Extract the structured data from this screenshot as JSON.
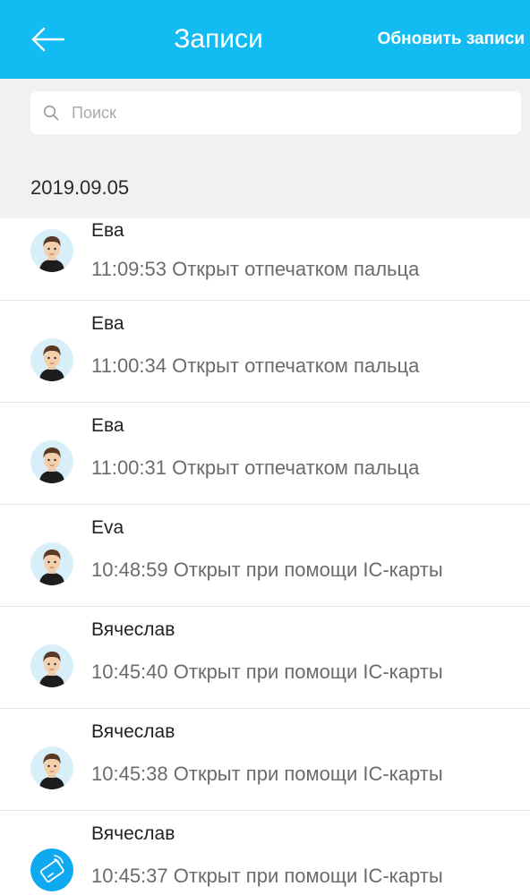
{
  "header": {
    "title": "Записи",
    "refresh_label": "Обновить записи",
    "back_icon": "arrow-left-icon",
    "background": "#12bcf2"
  },
  "search": {
    "placeholder": "Поиск",
    "value": "",
    "icon": "search-icon"
  },
  "date_group": "2019.09.05",
  "records": [
    {
      "name": "Ева",
      "detail": "11:09:53 Открыт отпечатком пальца",
      "avatar": "person-avatar"
    },
    {
      "name": "Ева",
      "detail": "11:00:34 Открыт отпечатком пальца",
      "avatar": "person-avatar"
    },
    {
      "name": "Ева",
      "detail": "11:00:31 Открыт отпечатком пальца",
      "avatar": "person-avatar"
    },
    {
      "name": "Eva",
      "detail": "10:48:59 Открыт при помощи IC-карты",
      "avatar": "person-avatar"
    },
    {
      "name": "Вячеслав",
      "detail": "10:45:40 Открыт при помощи IC-карты",
      "avatar": "person-avatar"
    },
    {
      "name": "Вячеслав",
      "detail": "10:45:38 Открыт при помощи IC-карты",
      "avatar": "person-avatar"
    },
    {
      "name": "Вячеслав",
      "detail": "10:45:37 Открыт при помощи IC-карты",
      "avatar": "card-avatar"
    }
  ]
}
